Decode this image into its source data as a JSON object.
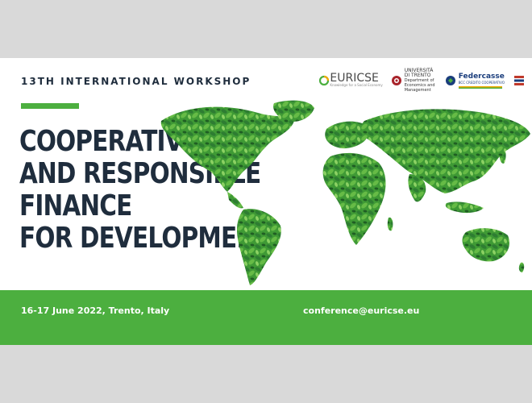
{
  "banner": {
    "workshop_label": "13TH INTERNATIONAL WORKSHOP",
    "title_lines": [
      "COOPERATIVE",
      "AND RESPONSIBLE",
      "FINANCE",
      "FOR DEVELOPMENT"
    ],
    "date_location": "16-17 June 2022, Trento, Italy",
    "email": "conference@euricse.eu"
  },
  "logos": {
    "euricse_name": "EURICSE",
    "euricse_tagline": "Knowledge for a Social Economy",
    "unitn_name": "UNIVERSITÀ DI TRENTO",
    "unitn_department": "Department of Economics and Management",
    "federcasse_name": "Federcasse",
    "federcasse_sub": "BCC CREDITO COOPERATIVO"
  },
  "colors": {
    "accent_green": "#4caf3f",
    "title_navy": "#1f2d3d",
    "leaf_dark": "#2e7d32",
    "leaf_light": "#66bb46"
  }
}
